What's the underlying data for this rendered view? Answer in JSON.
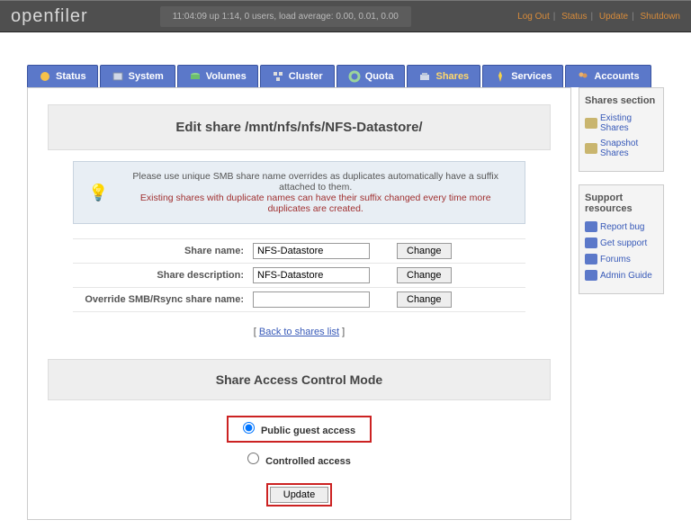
{
  "topbar": {
    "logo": "openfiler",
    "uptime": "11:04:09 up 1:14, 0 users, load average: 0.00, 0.01, 0.00",
    "links": {
      "logout": "Log Out",
      "status": "Status",
      "update": "Update",
      "shutdown": "Shutdown"
    }
  },
  "tabs": [
    {
      "key": "status",
      "label": "Status"
    },
    {
      "key": "system",
      "label": "System"
    },
    {
      "key": "volumes",
      "label": "Volumes"
    },
    {
      "key": "cluster",
      "label": "Cluster"
    },
    {
      "key": "quota",
      "label": "Quota"
    },
    {
      "key": "shares",
      "label": "Shares",
      "active": true
    },
    {
      "key": "services",
      "label": "Services"
    },
    {
      "key": "accounts",
      "label": "Accounts"
    }
  ],
  "edit": {
    "title": "Edit share /mnt/nfs/nfs/NFS-Datastore/",
    "warn_line1": "Please use unique SMB share name overrides as duplicates automatically have a suffix attached to them.",
    "warn_line2": "Existing shares with duplicate names can have their suffix changed every time more duplicates are created.",
    "fields": {
      "share_name": {
        "label": "Share name:",
        "value": "NFS-Datastore",
        "button": "Change"
      },
      "share_desc": {
        "label": "Share description:",
        "value": "NFS-Datastore",
        "button": "Change"
      },
      "smb_override": {
        "label": "Override SMB/Rsync share name:",
        "value": "",
        "button": "Change"
      }
    },
    "back_link": "Back to shares list"
  },
  "acm": {
    "title": "Share Access Control Mode",
    "options": {
      "public": {
        "label": "Public guest access",
        "checked": true
      },
      "controlled": {
        "label": "Controlled access",
        "checked": false
      }
    },
    "update_button": "Update"
  },
  "side": {
    "shares": {
      "title": "Shares section",
      "links": {
        "existing": "Existing Shares",
        "snapshot": "Snapshot Shares"
      }
    },
    "support": {
      "title": "Support resources",
      "links": {
        "report": "Report bug",
        "get": "Get support",
        "forums": "Forums",
        "admin": "Admin Guide"
      }
    }
  }
}
